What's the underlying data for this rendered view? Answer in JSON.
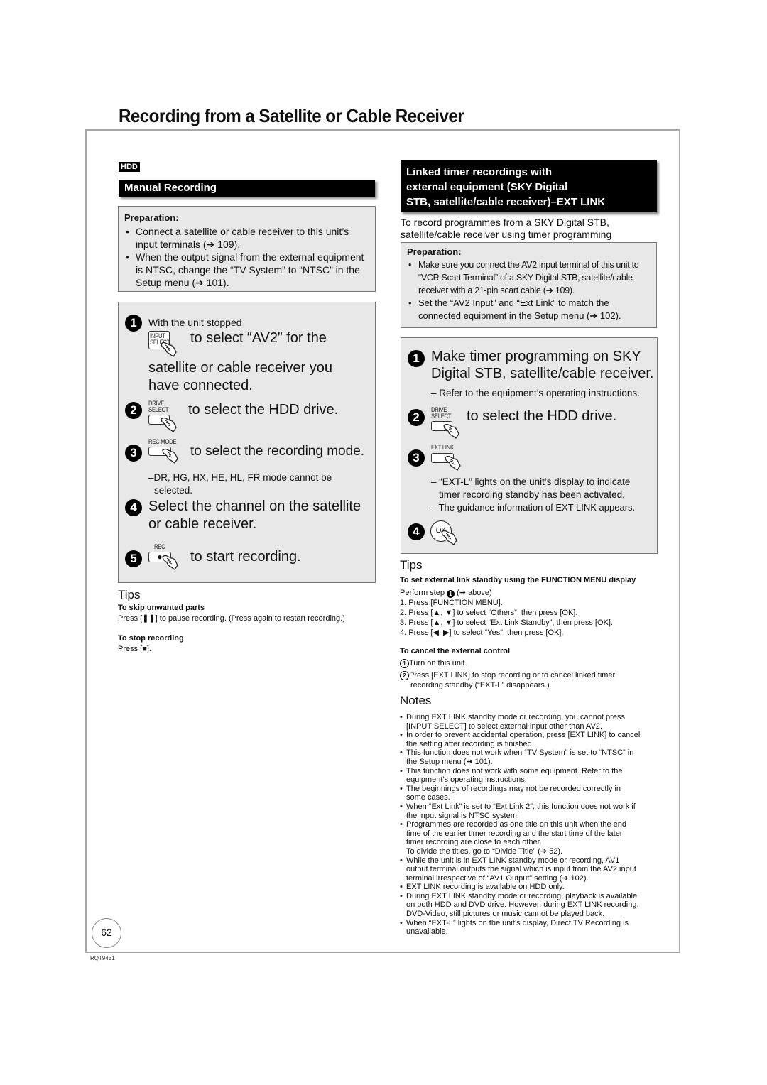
{
  "page": {
    "title": "Recording from a Satellite or Cable Receiver",
    "page_number": "62",
    "doc_code": "RQT9431"
  },
  "left": {
    "badge": "HDD",
    "section_title": "Manual Recording",
    "preparation": {
      "title": "Preparation:",
      "items": [
        "Connect a satellite or cable receiver to this unit’s input terminals (➔ 109).",
        "When the output signal from the external equipment is NTSC, change the “TV System” to “NTSC” in the Setup menu (➔ 101)."
      ]
    },
    "steps": [
      {
        "number": "1",
        "pre": "With the unit stopped",
        "button": [
          "INPUT",
          "SELECT"
        ],
        "text_line1": "to select “AV2” for the",
        "text_line2": "satellite or cable receiver you",
        "text_line3": "have connected."
      },
      {
        "number": "2",
        "button": [
          "DRIVE",
          "SELECT"
        ],
        "text": "to select the HDD drive."
      },
      {
        "number": "3",
        "button": [
          "REC MODE"
        ],
        "text": "to select the recording mode.",
        "note_line1": "–DR, HG, HX, HE, HL, FR mode cannot be",
        "note_line2": "selected."
      },
      {
        "number": "4",
        "text_line1": "Select the channel on the satellite",
        "text_line2": "or cable receiver."
      },
      {
        "number": "5",
        "button": [
          "REC"
        ],
        "button_symbol": "●",
        "text": "to start recording."
      }
    ],
    "tips": {
      "title": "Tips",
      "items": [
        {
          "heading": "To skip unwanted parts",
          "text": "Press [❚❚] to pause recording. (Press again to restart recording.)"
        },
        {
          "heading": "To stop recording",
          "text": "Press [■]."
        }
      ]
    }
  },
  "right": {
    "section_title_lines": [
      "Linked timer recordings with",
      "external equipment (SKY Digital",
      "STB, satellite/cable receiver)–EXT LINK"
    ],
    "intro_lines": [
      "To record programmes from a SKY Digital STB,",
      "satellite/cable receiver using timer programming"
    ],
    "preparation": {
      "title": "Preparation:",
      "items": [
        "Make sure you connect the AV2 input terminal of this unit to “VCR Scart Terminal” of a SKY Digital STB, satellite/cable receiver with a 21-pin scart cable (➔ 109).",
        "Set the “AV2 Input” and “Ext Link” to match the connected equipment in the Setup menu (➔ 102)."
      ]
    },
    "steps": [
      {
        "number": "1",
        "text_line1": "Make timer programming on SKY",
        "text_line2": "Digital STB, satellite/cable receiver.",
        "note": "– Refer to the equipment’s operating instructions."
      },
      {
        "number": "2",
        "button": [
          "DRIVE",
          "SELECT"
        ],
        "text": "to select the HDD drive."
      },
      {
        "number": "3",
        "button": [
          "EXT LINK"
        ],
        "note_line1": "– “EXT-L” lights on the unit’s display to indicate",
        "note_line2": "timer recording standby has been activated.",
        "note_line3": "– The guidance information of EXT LINK appears."
      },
      {
        "number": "4",
        "button": [
          "OK"
        ]
      }
    ],
    "tips": {
      "title": "Tips",
      "heading1": "To set external link standby using the FUNCTION MENU display",
      "perform_step_pre": "Perform step",
      "perform_step_num": "1",
      "perform_step_post": "(➔ above)",
      "numbered": [
        "1. Press [FUNCTION MENU].",
        "2. Press [▲, ▼] to select “Others”, then press [OK].",
        "3. Press [▲, ▼] to select “Ext Link Standby”, then press [OK].",
        "4. Press [◀, ▶] to select “Yes”, then press [OK]."
      ],
      "heading2": "To cancel the external control",
      "cancel_steps": [
        {
          "marker": "1",
          "text": "Turn on this unit."
        },
        {
          "marker": "2",
          "text_line1": "Press [EXT LINK] to stop recording or to cancel linked timer",
          "text_line2": "recording standby (“EXT-L” disappears.)."
        }
      ]
    },
    "notes": {
      "title": "Notes",
      "items": [
        [
          "During EXT LINK standby mode or recording, you cannot press",
          "[INPUT SELECT] to select external input other than AV2."
        ],
        [
          "In order to prevent accidental operation, press [EXT LINK] to cancel",
          "the setting after recording is finished."
        ],
        [
          "This function does not work when “TV System” is set to “NTSC” in",
          "the Setup menu (➔ 101)."
        ],
        [
          "This function does not work with some equipment. Refer to the",
          "equipment’s operating instructions."
        ],
        [
          "The beginnings of recordings may not be recorded correctly in",
          "some cases."
        ],
        [
          "When “Ext Link” is set to “Ext Link 2”, this function does not work if",
          "the input signal is NTSC system."
        ],
        [
          "Programmes are recorded as one title on this unit when the end",
          "time of the earlier timer recording and the start time of the later",
          "timer recording are close to each other.",
          "To divide the titles, go to “Divide Title” (➔ 52)."
        ],
        [
          "While the unit is in EXT LINK standby mode or recording, AV1",
          "output terminal outputs the signal which is input from the AV2 input",
          "terminal irrespective of “AV1 Output” setting (➔ 102)."
        ],
        [
          "EXT LINK recording is available on HDD only."
        ],
        [
          "During EXT LINK standby mode or recording, playback is available",
          "on both HDD and DVD drive. However, during EXT LINK recording,",
          "DVD-Video, still pictures or music cannot be played back."
        ],
        [
          "When “EXT-L” lights on the unit’s display, Direct TV Recording is",
          "unavailable."
        ]
      ]
    }
  }
}
